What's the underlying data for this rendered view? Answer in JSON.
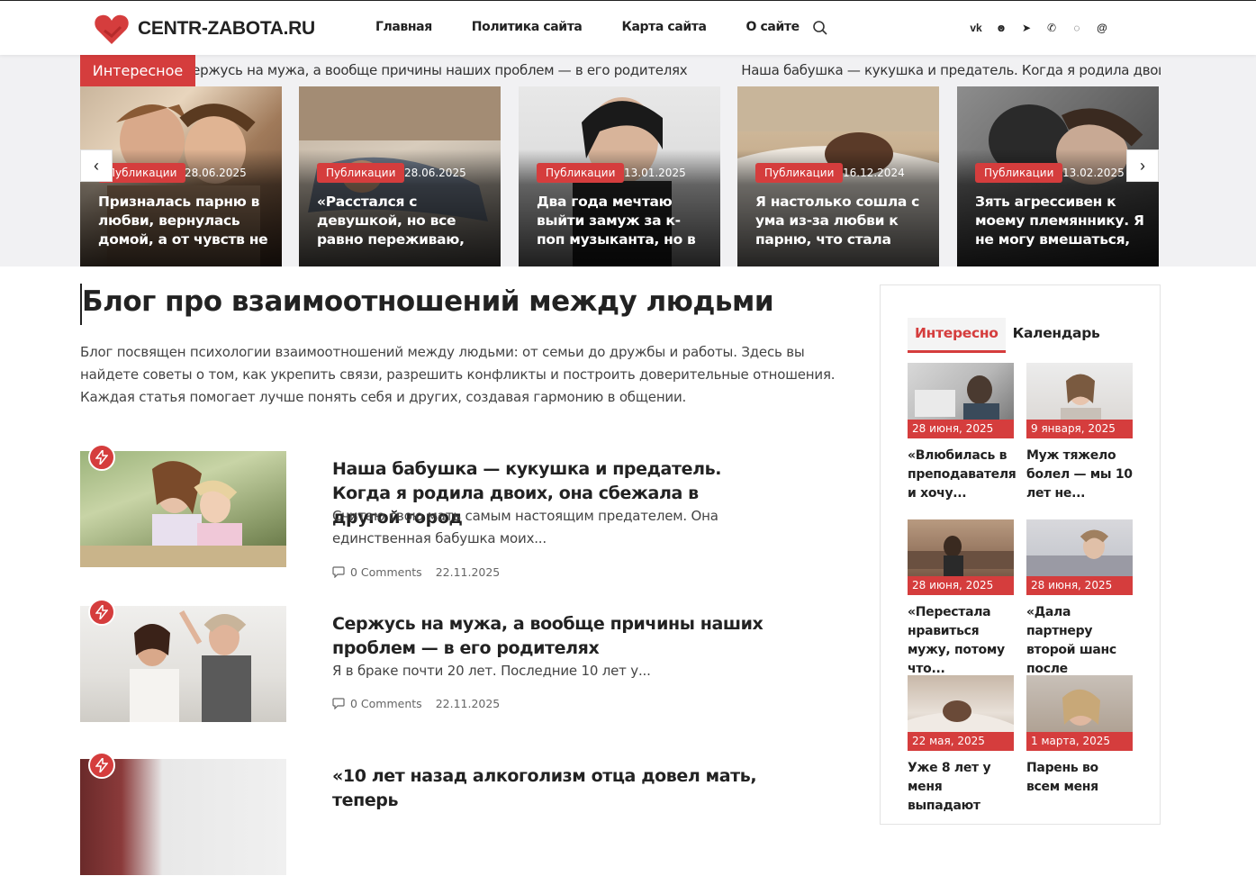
{
  "site": {
    "logo_text": "CENTR-ZABOTA.RU",
    "nav": [
      "Главная",
      "Политика сайта",
      "Карта сайта",
      "О сайте"
    ],
    "social": [
      "vk-icon",
      "odnoklassniki-icon",
      "telegram-icon",
      "viber-icon",
      "whatsapp-icon",
      "moimir-icon"
    ],
    "accent": "#d53d3d"
  },
  "ticker": {
    "label": "Интересное",
    "items": [
      "Сержусь на мужа, а вообще причины наших проблем — в его родителях",
      "Наша бабушка — кукушка и предатель. Когда я родила двоих, она сбежала в другой город"
    ]
  },
  "featured": [
    {
      "badge": "Публикации",
      "date": "28.06.2025",
      "title": "Призналась парню в любви, вернулась домой, а от чувств не осталось и следа"
    },
    {
      "badge": "Публикации",
      "date": "28.06.2025",
      "title": "«Расстался с девушкой, но все равно переживаю, что она найдет другого»"
    },
    {
      "badge": "Публикации",
      "date": "13.01.2025",
      "title": "Два года мечтаю выйти замуж за к-поп музыканта, но в реальности все сложнее"
    },
    {
      "badge": "Публикации",
      "date": "16.12.2024",
      "title": "Я настолько сошла с ума из-за любви к парню, что стала ощущать на себе его боль"
    },
    {
      "badge": "Публикации",
      "date": "13.02.2025",
      "title": "Зять агрессивен к моему племяннику. Я не могу вмешаться, но и молчать не могу"
    }
  ],
  "main": {
    "title": "Блог про взаимоотношений между людьми",
    "intro": "Блог посвящен психологии взаимоотношений между людьми: от семьи до дружбы и работы. Здесь вы найдете советы о том, как укрепить связи, разрешить конфликты и построить доверительные отношения. Каждая статья помогает лучше понять себя и других, создавая гармонию в общении.",
    "posts": [
      {
        "title": "Наша бабушка — кукушка и предатель. Когда я родила двоих, она сбежала в другой город",
        "excerpt": "Считаю свою мать самым настоящим предателем. Она единственная бабушка моих...",
        "comments": "0 Comments",
        "date": "22.11.2025"
      },
      {
        "title": "Сержусь на мужа, а вообще причины наших проблем — в его родителях",
        "excerpt": "Я в браке почти 20 лет. Последние 10 лет у...",
        "comments": "0 Comments",
        "date": "22.11.2025"
      },
      {
        "title": "«10 лет назад алкоголизм отца довел мать, теперь",
        "excerpt": "",
        "comments": "",
        "date": ""
      }
    ]
  },
  "sidebar": {
    "tabs": [
      "Интересно",
      "Календарь"
    ],
    "items": [
      {
        "date": "28 июня, 2025",
        "title": "«Влюбилась в преподавателя и хочу..."
      },
      {
        "date": "9 января, 2025",
        "title": "Муж тяжело болел — мы 10 лет не..."
      },
      {
        "date": "28 июня, 2025",
        "title": "«Перестала нравиться мужу, потому что..."
      },
      {
        "date": "28 июня, 2025",
        "title": "«Дала партнеру второй шанс после измены,..."
      },
      {
        "date": "22 мая, 2025",
        "title": "Уже 8 лет у меня выпадают"
      },
      {
        "date": "1 марта, 2025",
        "title": "Парень во всем меня"
      }
    ]
  }
}
